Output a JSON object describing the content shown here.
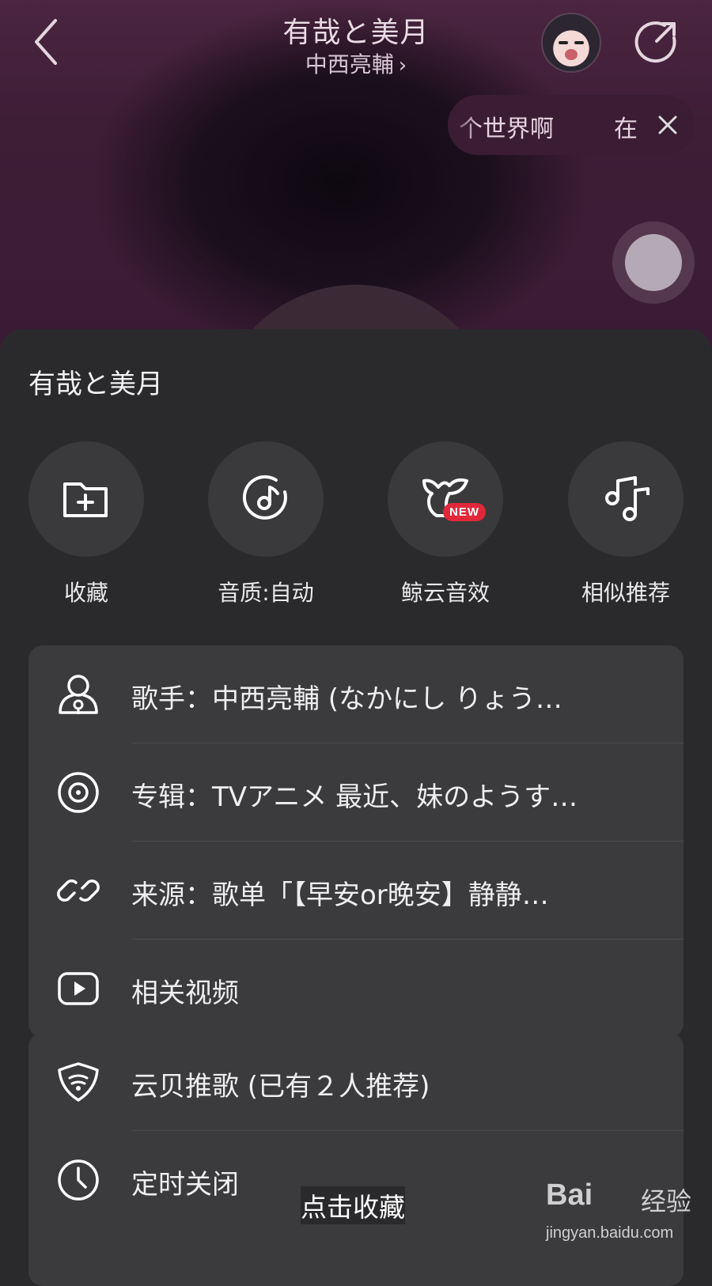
{
  "player": {
    "title": "有哉と美月",
    "artist": "中西亮輔",
    "artist_chevron": "›",
    "lyric_current": "个世界啊",
    "lyric_next": "在",
    "icons": {
      "back": "back-arrow-icon",
      "share": "share-icon",
      "close": "close-icon"
    }
  },
  "sheet": {
    "title": "有哉と美月",
    "quick_actions": [
      {
        "label": "收藏",
        "icon": "folder-add-icon"
      },
      {
        "label": "音质:自动",
        "icon": "music-disc-icon"
      },
      {
        "label": "鲸云音效",
        "icon": "whale-tail-icon",
        "badge": "NEW"
      },
      {
        "label": "相似推荐",
        "icon": "music-notes-icon"
      }
    ],
    "info_rows": [
      {
        "label": "歌手：中西亮輔 (なかにし りょう…",
        "icon": "person-icon"
      },
      {
        "label": "专辑：TVアニメ 最近、妹のようす…",
        "icon": "album-disc-icon"
      },
      {
        "label": "来源：歌单「【早安or晚安】静静…",
        "icon": "link-icon"
      },
      {
        "label": "相关视频",
        "icon": "play-video-icon"
      }
    ],
    "action_rows": [
      {
        "label": "云贝推歌 (已有２人推荐)",
        "icon": "yunbei-icon"
      },
      {
        "label": "定时关闭",
        "icon": "clock-icon"
      }
    ]
  },
  "annotation": "点击收藏",
  "watermark": {
    "brand": "Bai",
    "cn": "经验",
    "url": "jingyan.baidu.com"
  },
  "colors": {
    "sheet_bg": "#2a2a2d",
    "card_bg": "#3b3b3e",
    "badge_red": "#e0283a",
    "player_bg": "#3e1d37"
  }
}
